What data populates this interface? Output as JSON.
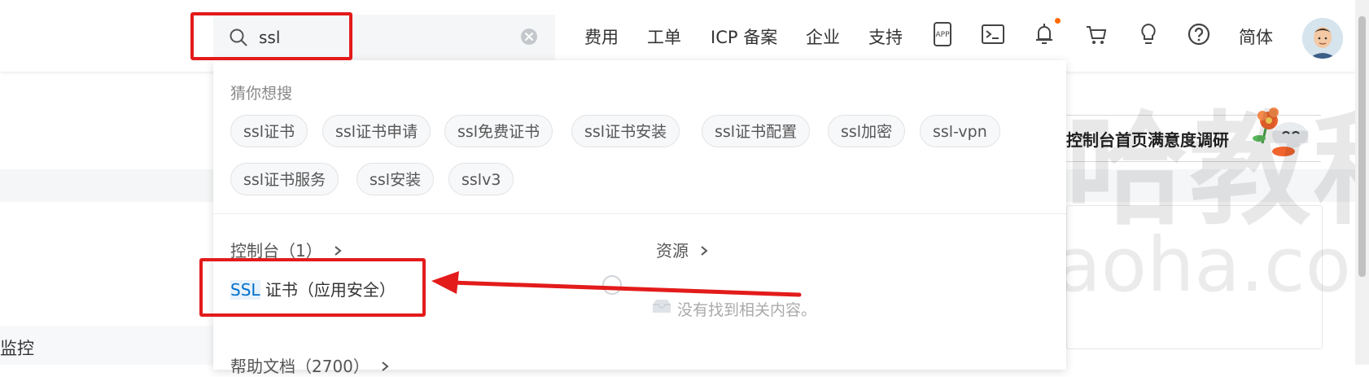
{
  "header": {
    "search": {
      "value": "ssl"
    },
    "nav": [
      "费用",
      "工单",
      "ICP 备案",
      "企业",
      "支持"
    ],
    "icons": [
      "app-download-icon",
      "terminal-icon",
      "bell-icon",
      "cart-icon",
      "lightbulb-icon",
      "help-icon"
    ],
    "language": "简体",
    "notify_color": "#ff6a00"
  },
  "dropdown": {
    "guess_title": "猜你想搜",
    "chips": [
      "ssl证书",
      "ssl证书申请",
      "ssl免费证书",
      "ssl证书安装",
      "ssl证书配置",
      "ssl加密",
      "ssl-vpn",
      "ssl证书服务",
      "ssl安装",
      "sslv3"
    ],
    "console_title": "控制台（1）",
    "resources_title": "资源",
    "result": {
      "highlight": "SSL",
      "rest": " 证书（应用安全）"
    },
    "empty_text": "没有找到相关内容。",
    "help_title": "帮助文档（2700）"
  },
  "background": {
    "survey": "控制台首页满意度调研",
    "left_label": "监控"
  },
  "watermark": {
    "line1": "犬小哈教程",
    "line2": "quanxiaoha.com"
  },
  "annotation_color": "#e31b1b",
  "highlight_color": "#0070cc"
}
